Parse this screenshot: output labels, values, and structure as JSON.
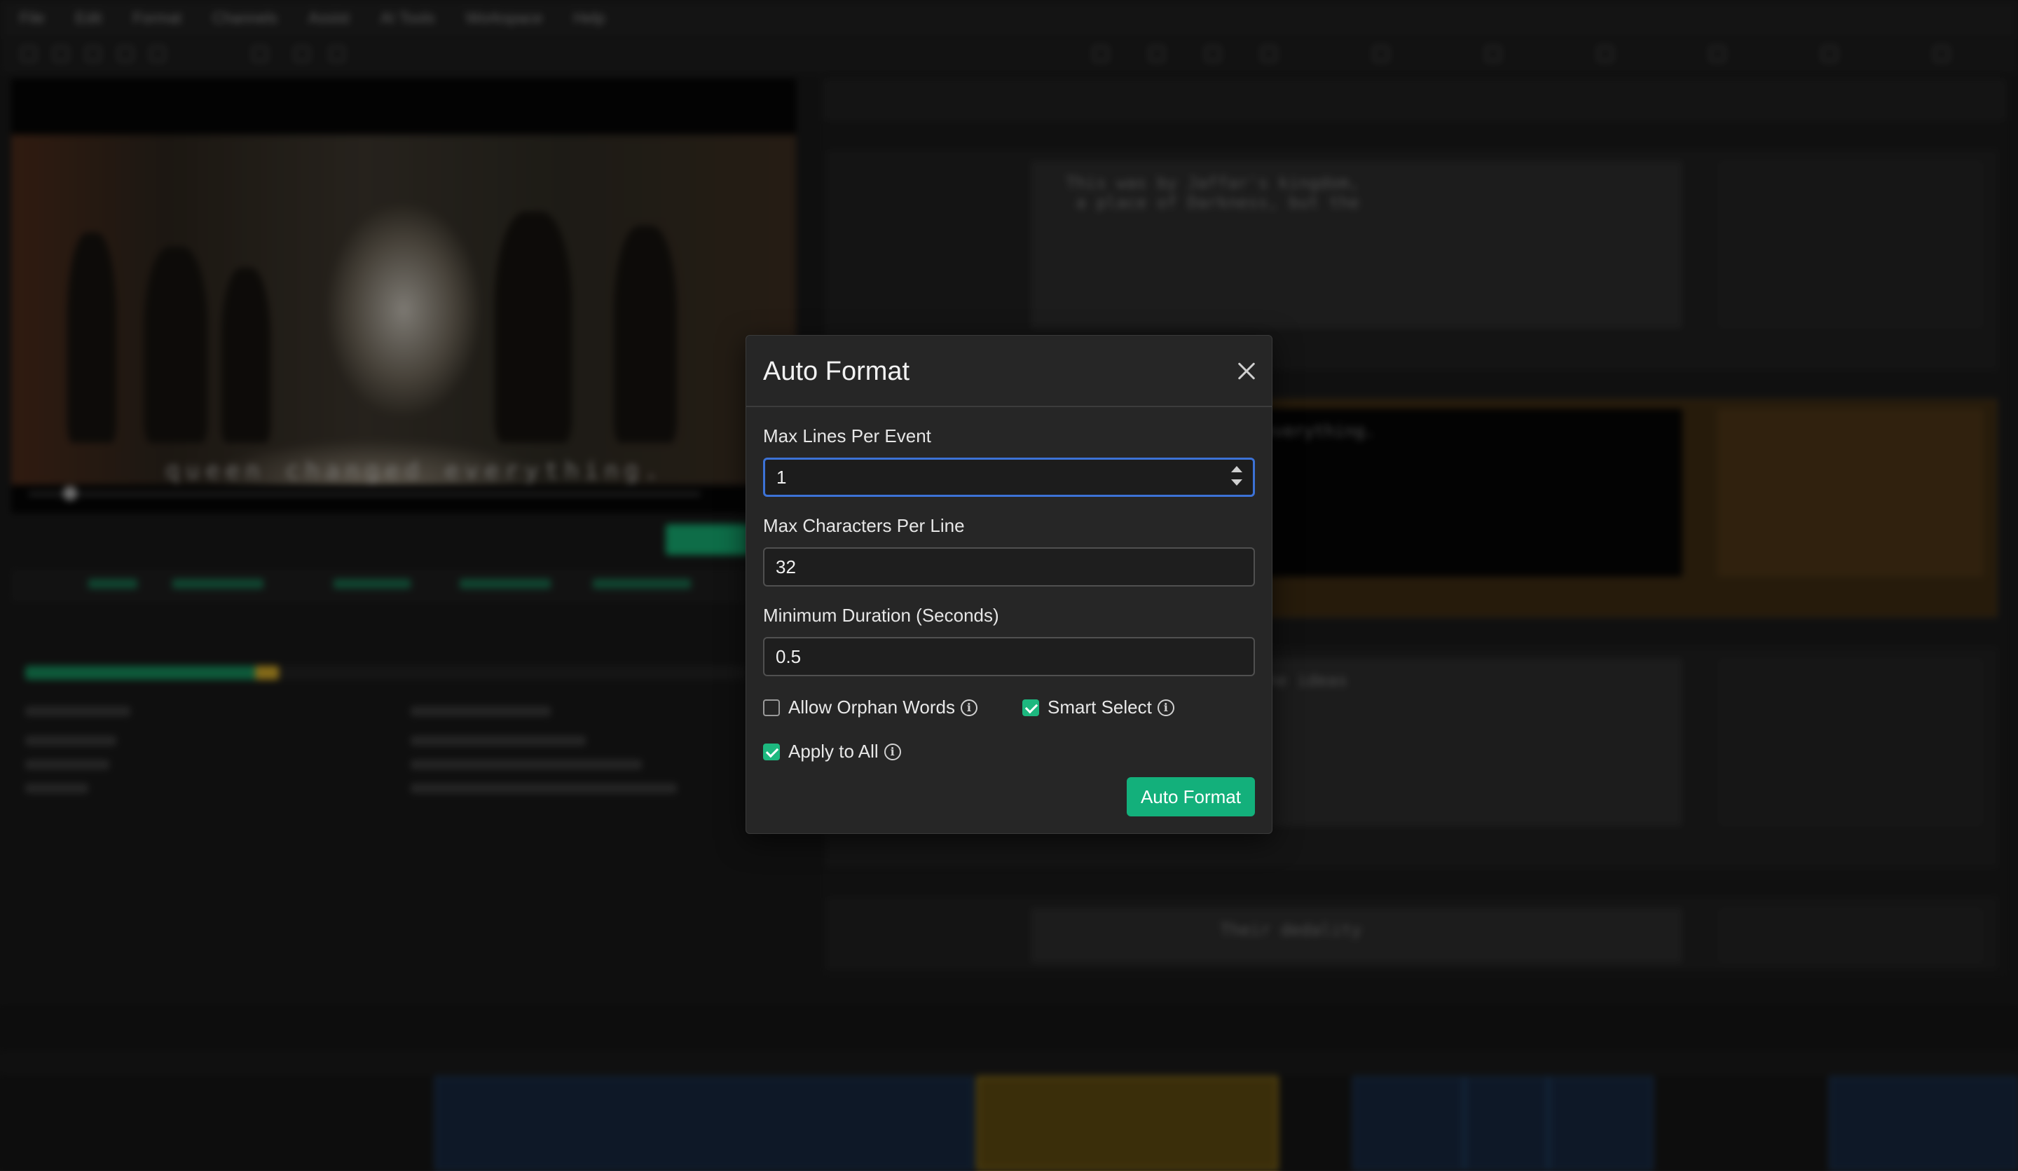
{
  "background": {
    "menu": [
      "File",
      "Edit",
      "Format",
      "Channels",
      "Assist",
      "AI Tools",
      "Workspace",
      "Help"
    ],
    "burned_subtitle": "queen changed everything.",
    "rows": [
      {
        "text": "This was by Jaffar's kingdom,\n a place of Darkness, but the"
      },
      {
        "text": "queen changed everything."
      },
      {
        "text": "Then the ideas"
      },
      {
        "text": "Their dedality"
      }
    ]
  },
  "dialog": {
    "title": "Auto Format",
    "fields": [
      {
        "label": "Max Lines Per Event",
        "value": "1"
      },
      {
        "label": "Max Characters Per Line",
        "value": "32"
      },
      {
        "label": "Minimum Duration (Seconds)",
        "value": "0.5"
      }
    ],
    "options": {
      "allow_orphan": {
        "label": "Allow Orphan Words",
        "checked": false
      },
      "smart_select": {
        "label": "Smart Select",
        "checked": true
      },
      "apply_all": {
        "label": "Apply to All",
        "checked": true
      }
    },
    "submit_label": "Auto Format",
    "info_glyph": "i"
  },
  "colors": {
    "accent": "#13b07b",
    "focus": "#3c72d6",
    "highlight": "#c9a227"
  }
}
